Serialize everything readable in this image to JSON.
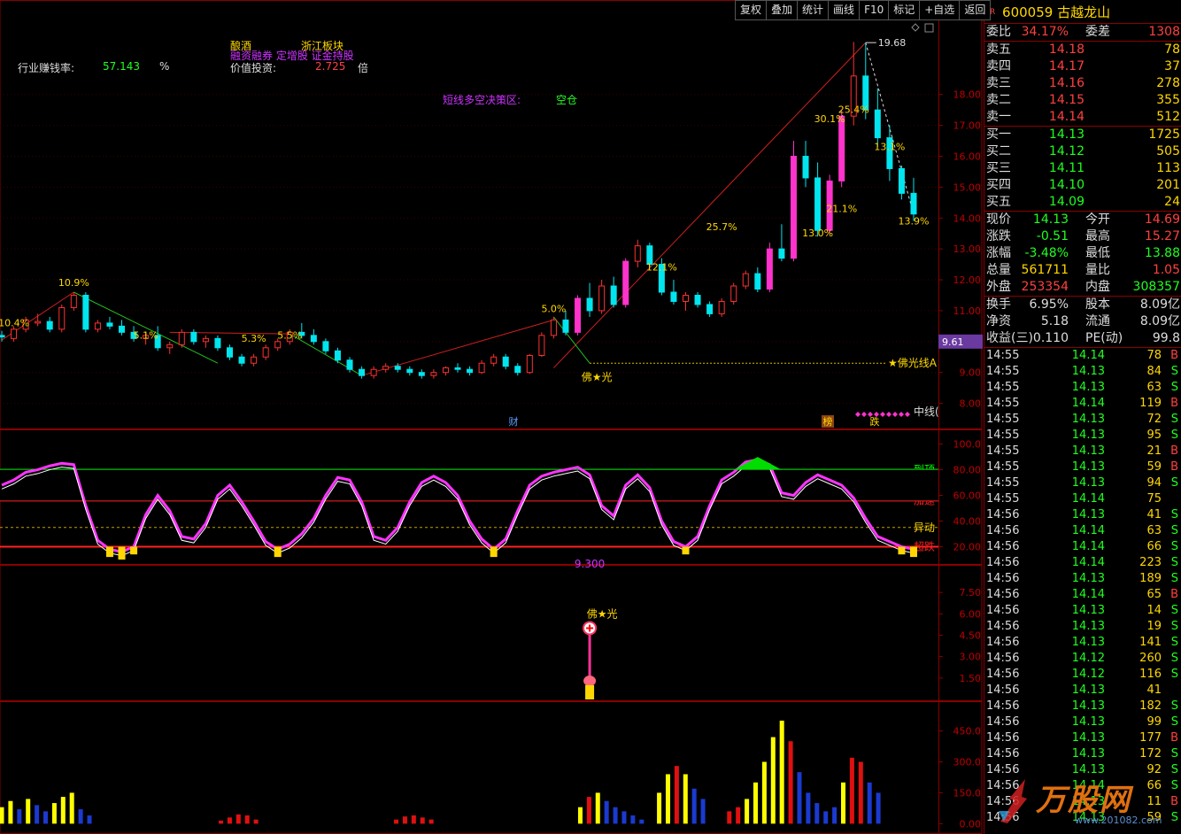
{
  "toolbar": {
    "items": [
      "复权",
      "叠加",
      "统计",
      "画线",
      "F10",
      "标记",
      "+自选",
      "返回"
    ]
  },
  "top_indicators": {
    "industry_label": "行业赚钱率:",
    "industry_value": "57.143",
    "industry_unit": "%",
    "tag_liquor": "酿酒",
    "tag_zhejiang": "浙江板块",
    "tag_margin": "融资融券 定增股 证金持股",
    "value_label": "价值投资:",
    "value_value": "2.725",
    "value_unit": "倍",
    "strategy_label": "短线多空决策区:",
    "strategy_value": "空仓"
  },
  "colors": {
    "up": "#ff3030",
    "down": "#00e5ee",
    "limit": "#ff33cc",
    "text_red": "#ff4040",
    "text_green": "#20ff20",
    "gold": "#ffd700",
    "purple": "#cc33ff"
  },
  "chart_data": [
    {
      "type": "candlestick",
      "title": "",
      "ylim": [
        7.3,
        20.2
      ],
      "yticks": [
        "18.00",
        "17.00",
        "16.00",
        "15.00",
        "14.00",
        "13.00",
        "12.00",
        "11.00",
        "10.00",
        "9.00",
        "8.00"
      ],
      "ohlc": [
        [
          10.2,
          10.35,
          10.0,
          10.15
        ],
        [
          10.1,
          10.5,
          10.0,
          10.4
        ],
        [
          10.4,
          10.8,
          10.3,
          10.7
        ],
        [
          10.6,
          10.9,
          10.5,
          10.65
        ],
        [
          10.65,
          10.8,
          10.3,
          10.4
        ],
        [
          10.4,
          11.2,
          10.3,
          11.1
        ],
        [
          11.1,
          11.6,
          11.0,
          11.5
        ],
        [
          11.5,
          11.6,
          10.3,
          10.4
        ],
        [
          10.4,
          10.7,
          10.3,
          10.6
        ],
        [
          10.6,
          10.8,
          10.4,
          10.5
        ],
        [
          10.5,
          10.7,
          10.2,
          10.3
        ],
        [
          10.3,
          10.5,
          10.0,
          10.1
        ],
        [
          10.1,
          10.3,
          9.9,
          10.2
        ],
        [
          10.2,
          10.5,
          9.7,
          9.8
        ],
        [
          9.8,
          10.0,
          9.6,
          9.9
        ],
        [
          9.9,
          10.4,
          9.8,
          10.3
        ],
        [
          10.3,
          10.4,
          9.9,
          10.0
        ],
        [
          10.0,
          10.2,
          9.8,
          10.1
        ],
        [
          10.1,
          10.2,
          9.7,
          9.8
        ],
        [
          9.8,
          9.9,
          9.4,
          9.5
        ],
        [
          9.5,
          9.6,
          9.2,
          9.3
        ],
        [
          9.3,
          9.6,
          9.2,
          9.5
        ],
        [
          9.5,
          9.9,
          9.4,
          9.8
        ],
        [
          9.8,
          10.1,
          9.7,
          10.0
        ],
        [
          10.0,
          10.4,
          9.9,
          10.3
        ],
        [
          10.3,
          10.6,
          10.1,
          10.2
        ],
        [
          10.2,
          10.4,
          9.9,
          10.0
        ],
        [
          10.0,
          10.1,
          9.6,
          9.7
        ],
        [
          9.7,
          9.8,
          9.3,
          9.4
        ],
        [
          9.4,
          9.5,
          9.0,
          9.1
        ],
        [
          9.1,
          9.2,
          8.8,
          8.9
        ],
        [
          8.9,
          9.2,
          8.8,
          9.1
        ],
        [
          9.1,
          9.3,
          9.0,
          9.2
        ],
        [
          9.2,
          9.3,
          9.0,
          9.1
        ],
        [
          9.1,
          9.2,
          8.9,
          9.0
        ],
        [
          9.0,
          9.1,
          8.8,
          8.9
        ],
        [
          8.9,
          9.1,
          8.8,
          9.0
        ],
        [
          9.0,
          9.2,
          8.9,
          9.15
        ],
        [
          9.15,
          9.3,
          9.0,
          9.1
        ],
        [
          9.1,
          9.2,
          8.9,
          9.0
        ],
        [
          9.0,
          9.4,
          8.95,
          9.3
        ],
        [
          9.3,
          9.6,
          9.2,
          9.5
        ],
        [
          9.5,
          9.6,
          9.1,
          9.2
        ],
        [
          9.2,
          9.3,
          8.9,
          9.0
        ],
        [
          9.0,
          9.6,
          8.95,
          9.55
        ],
        [
          9.55,
          10.3,
          9.5,
          10.2
        ],
        [
          10.2,
          10.8,
          10.1,
          10.7
        ],
        [
          10.7,
          11.0,
          10.2,
          10.3
        ],
        [
          10.3,
          11.5,
          10.2,
          11.4
        ],
        [
          11.4,
          11.9,
          10.8,
          11.0
        ],
        [
          11.0,
          12.0,
          10.9,
          11.8
        ],
        [
          11.8,
          12.1,
          11.1,
          11.2
        ],
        [
          11.2,
          12.7,
          11.1,
          12.6
        ],
        [
          12.6,
          13.3,
          12.4,
          13.1
        ],
        [
          13.1,
          13.2,
          12.4,
          12.5
        ],
        [
          12.5,
          12.7,
          11.5,
          11.6
        ],
        [
          11.6,
          12.0,
          11.2,
          11.3
        ],
        [
          11.3,
          11.6,
          11.0,
          11.5
        ],
        [
          11.5,
          11.6,
          11.1,
          11.2
        ],
        [
          11.2,
          11.3,
          10.8,
          10.9
        ],
        [
          10.9,
          11.4,
          10.8,
          11.3
        ],
        [
          11.3,
          11.9,
          11.2,
          11.8
        ],
        [
          11.8,
          12.3,
          11.7,
          12.2
        ],
        [
          12.2,
          12.4,
          11.6,
          11.7
        ],
        [
          11.7,
          13.2,
          11.6,
          13.0
        ],
        [
          13.0,
          13.8,
          12.6,
          12.7
        ],
        [
          12.7,
          16.5,
          12.6,
          16.0
        ],
        [
          16.0,
          16.5,
          15.0,
          15.3
        ],
        [
          15.3,
          15.8,
          13.4,
          13.6
        ],
        [
          13.6,
          15.4,
          13.5,
          15.2
        ],
        [
          15.2,
          17.5,
          15.0,
          17.3
        ],
        [
          17.3,
          19.7,
          17.0,
          18.6
        ],
        [
          18.6,
          19.68,
          17.2,
          17.5
        ],
        [
          17.5,
          18.2,
          16.3,
          16.6
        ],
        [
          16.6,
          17.0,
          15.2,
          15.6
        ],
        [
          15.6,
          15.7,
          14.6,
          14.8
        ],
        [
          14.8,
          15.3,
          13.9,
          14.13
        ]
      ]
    },
    {
      "type": "line",
      "title": "",
      "ylim": [
        10,
        108
      ],
      "yticks": [
        "100.0",
        "80.00",
        "60.00",
        "40.00",
        "20.00"
      ],
      "levels": [
        {
          "value": 80,
          "label": "到顶",
          "color": "#00ff00"
        },
        {
          "value": 56,
          "label": "加速",
          "color": "#ff2020"
        },
        {
          "value": 35,
          "label": "异动",
          "color": "#c8a000"
        },
        {
          "value": 20,
          "label": "超跌",
          "color": "#ff2020"
        }
      ],
      "series": [
        {
          "color": "#ff33ff",
          "values": [
            68,
            72,
            78,
            80,
            83,
            85,
            84,
            52,
            25,
            18,
            16,
            20,
            45,
            60,
            48,
            28,
            26,
            38,
            60,
            68,
            55,
            40,
            24,
            18,
            22,
            30,
            42,
            60,
            74,
            72,
            55,
            28,
            25,
            35,
            55,
            70,
            75,
            70,
            60,
            40,
            26,
            18,
            26,
            48,
            68,
            75,
            78,
            80,
            82,
            76,
            52,
            44,
            68,
            76,
            66,
            40,
            24,
            20,
            28,
            52,
            72,
            78,
            86,
            88,
            84,
            62,
            60,
            70,
            76,
            72,
            68,
            58,
            42,
            28,
            24,
            20,
            18
          ]
        }
      ]
    },
    {
      "type": "bar",
      "title": "",
      "ylim": [
        0,
        9
      ],
      "yticks": [
        "7.50",
        "6.00",
        "4.50",
        "3.00",
        "1.50"
      ],
      "annotations": [
        {
          "text": "9.300"
        },
        {
          "text": "佛★光"
        }
      ]
    },
    {
      "type": "bar",
      "title": "",
      "ylim": [
        -20,
        560
      ],
      "yticks": [
        "450.0",
        "300.0",
        "150.0",
        "0.00"
      ],
      "values": [
        80,
        110,
        70,
        120,
        90,
        60,
        100,
        130,
        150,
        70,
        40,
        0,
        0,
        0,
        0,
        0,
        0,
        0,
        0,
        0,
        0,
        0,
        0,
        0,
        0,
        15,
        30,
        45,
        40,
        20,
        0,
        0,
        0,
        0,
        0,
        0,
        0,
        0,
        0,
        0,
        0,
        0,
        0,
        0,
        0,
        20,
        35,
        40,
        30,
        20,
        0,
        0,
        0,
        0,
        0,
        0,
        0,
        0,
        0,
        0,
        0,
        0,
        0,
        0,
        0,
        0,
        80,
        130,
        150,
        110,
        80,
        60,
        40,
        20,
        0,
        150,
        240,
        280,
        240,
        170,
        120,
        0,
        0,
        60,
        80,
        120,
        200,
        300,
        420,
        500,
        400,
        250,
        150,
        100,
        60,
        80,
        200,
        320,
        300,
        200,
        150,
        0
      ],
      "colors": [
        "yellow",
        "yellow",
        "blue",
        "yellow",
        "blue",
        "blue",
        "yellow",
        "yellow",
        "yellow",
        "blue",
        "blue",
        "blue",
        "blue",
        "blue",
        "blue",
        "blue",
        "blue",
        "blue",
        "blue",
        "blue",
        "blue",
        "blue",
        "blue",
        "blue",
        "blue",
        "red",
        "red",
        "red",
        "red",
        "red",
        "red",
        "red",
        "red",
        "red",
        "red",
        "red",
        "red",
        "red",
        "red",
        "red",
        "red",
        "red",
        "red",
        "red",
        "red",
        "red",
        "red",
        "red",
        "red",
        "red",
        "red",
        "red",
        "red",
        "red",
        "red",
        "red",
        "red",
        "red",
        "red",
        "red",
        "red",
        "red",
        "red",
        "red",
        "red",
        "red",
        "yellow",
        "red",
        "yellow",
        "blue",
        "blue",
        "blue",
        "blue",
        "blue",
        "blue",
        "yellow",
        "yellow",
        "red",
        "yellow",
        "blue",
        "blue",
        "blue",
        "blue",
        "red",
        "red",
        "yellow",
        "yellow",
        "yellow",
        "yellow",
        "yellow",
        "red",
        "blue",
        "blue",
        "blue",
        "blue",
        "blue",
        "yellow",
        "red",
        "red",
        "blue",
        "blue",
        "blue"
      ]
    }
  ],
  "chart_labels": {
    "pct_labels": [
      "10.4%",
      "10.9%",
      "5.1%",
      "5.3%",
      "5.5%",
      "5.0%",
      "12.1%",
      "25.7%",
      "13.0%",
      "21.1%",
      "30.1%",
      "25.4%",
      "13.1%",
      "13.9%"
    ],
    "peak_label": "19.68",
    "foguang": "佛★光",
    "foguang_line": "★佛光线A",
    "current_price_tag": "9.61",
    "badge_cai": "财",
    "badge_bang": "榜",
    "badge_die": "跌",
    "zhongxian": "中线("
  },
  "panel": {
    "code": "600059",
    "name": "古越龙山",
    "mark": "R",
    "weibi_label": "委比",
    "weibi": "34.17%",
    "weicha_label": "委差",
    "weicha": "1308",
    "asks": [
      {
        "label": "卖五",
        "price": "14.18",
        "vol": "78"
      },
      {
        "label": "卖四",
        "price": "14.17",
        "vol": "37"
      },
      {
        "label": "卖三",
        "price": "14.16",
        "vol": "278"
      },
      {
        "label": "卖二",
        "price": "14.15",
        "vol": "355"
      },
      {
        "label": "卖一",
        "price": "14.14",
        "vol": "512"
      }
    ],
    "bids": [
      {
        "label": "买一",
        "price": "14.13",
        "vol": "1725"
      },
      {
        "label": "买二",
        "price": "14.12",
        "vol": "505"
      },
      {
        "label": "买三",
        "price": "14.11",
        "vol": "113"
      },
      {
        "label": "买四",
        "price": "14.10",
        "vol": "201"
      },
      {
        "label": "买五",
        "price": "14.09",
        "vol": "24"
      }
    ],
    "quote": [
      {
        "l1": "现价",
        "v1": "14.13",
        "c1": "grn",
        "l2": "今开",
        "v2": "14.69",
        "c2": "red"
      },
      {
        "l1": "涨跌",
        "v1": "-0.51",
        "c1": "grn",
        "l2": "最高",
        "v2": "15.27",
        "c2": "red"
      },
      {
        "l1": "涨幅",
        "v1": "-3.48%",
        "c1": "grn",
        "l2": "最低",
        "v2": "13.88",
        "c2": "grn"
      },
      {
        "l1": "总量",
        "v1": "561711",
        "c1": "yel",
        "l2": "量比",
        "v2": "1.05",
        "c2": "red"
      },
      {
        "l1": "外盘",
        "v1": "253354",
        "c1": "red",
        "l2": "内盘",
        "v2": "308357",
        "c2": "grn"
      }
    ],
    "fin": [
      {
        "l1": "换手",
        "v1": "6.95%",
        "l2": "股本",
        "v2": "8.09亿"
      },
      {
        "l1": "净资",
        "v1": "5.18",
        "l2": "流通",
        "v2": "8.09亿"
      },
      {
        "l1": "收益(三)",
        "v1": "0.110",
        "l2": "PE(动)",
        "v2": "99.8"
      }
    ],
    "ticks": [
      [
        "14:55",
        "14.14",
        "78",
        "B"
      ],
      [
        "14:55",
        "14.13",
        "84",
        "S"
      ],
      [
        "14:55",
        "14.13",
        "63",
        "S"
      ],
      [
        "14:55",
        "14.14",
        "119",
        "B"
      ],
      [
        "14:55",
        "14.13",
        "72",
        "S"
      ],
      [
        "14:55",
        "14.13",
        "95",
        "S"
      ],
      [
        "14:55",
        "14.13",
        "21",
        "B"
      ],
      [
        "14:55",
        "14.13",
        "59",
        "B"
      ],
      [
        "14:55",
        "14.13",
        "94",
        "S"
      ],
      [
        "14:55",
        "14.14",
        "75",
        ""
      ],
      [
        "14:56",
        "14.13",
        "41",
        "S"
      ],
      [
        "14:56",
        "14.14",
        "63",
        "S"
      ],
      [
        "14:56",
        "14.14",
        "66",
        "S"
      ],
      [
        "14:56",
        "14.14",
        "223",
        "S"
      ],
      [
        "14:56",
        "14.13",
        "189",
        "S"
      ],
      [
        "14:56",
        "14.14",
        "65",
        "B"
      ],
      [
        "14:56",
        "14.13",
        "14",
        "S"
      ],
      [
        "14:56",
        "14.13",
        "19",
        "S"
      ],
      [
        "14:56",
        "14.13",
        "141",
        "S"
      ],
      [
        "14:56",
        "14.12",
        "260",
        "S"
      ],
      [
        "14:56",
        "14.12",
        "116",
        "S"
      ],
      [
        "14:56",
        "14.13",
        "41",
        ""
      ],
      [
        "14:56",
        "14.13",
        "182",
        "S"
      ],
      [
        "14:56",
        "14.13",
        "99",
        "S"
      ],
      [
        "14:56",
        "14.13",
        "177",
        "B"
      ],
      [
        "14:56",
        "14.13",
        "172",
        "S"
      ],
      [
        "14:56",
        "14.13",
        "92",
        "S"
      ],
      [
        "14:56",
        "14.14",
        "66",
        "S"
      ],
      [
        "14:56",
        "14.13",
        "11",
        "B"
      ],
      [
        "14:56",
        "14.13",
        "59",
        "S"
      ]
    ]
  },
  "watermark": {
    "brand": "万股网",
    "url": "www.201082.com"
  }
}
